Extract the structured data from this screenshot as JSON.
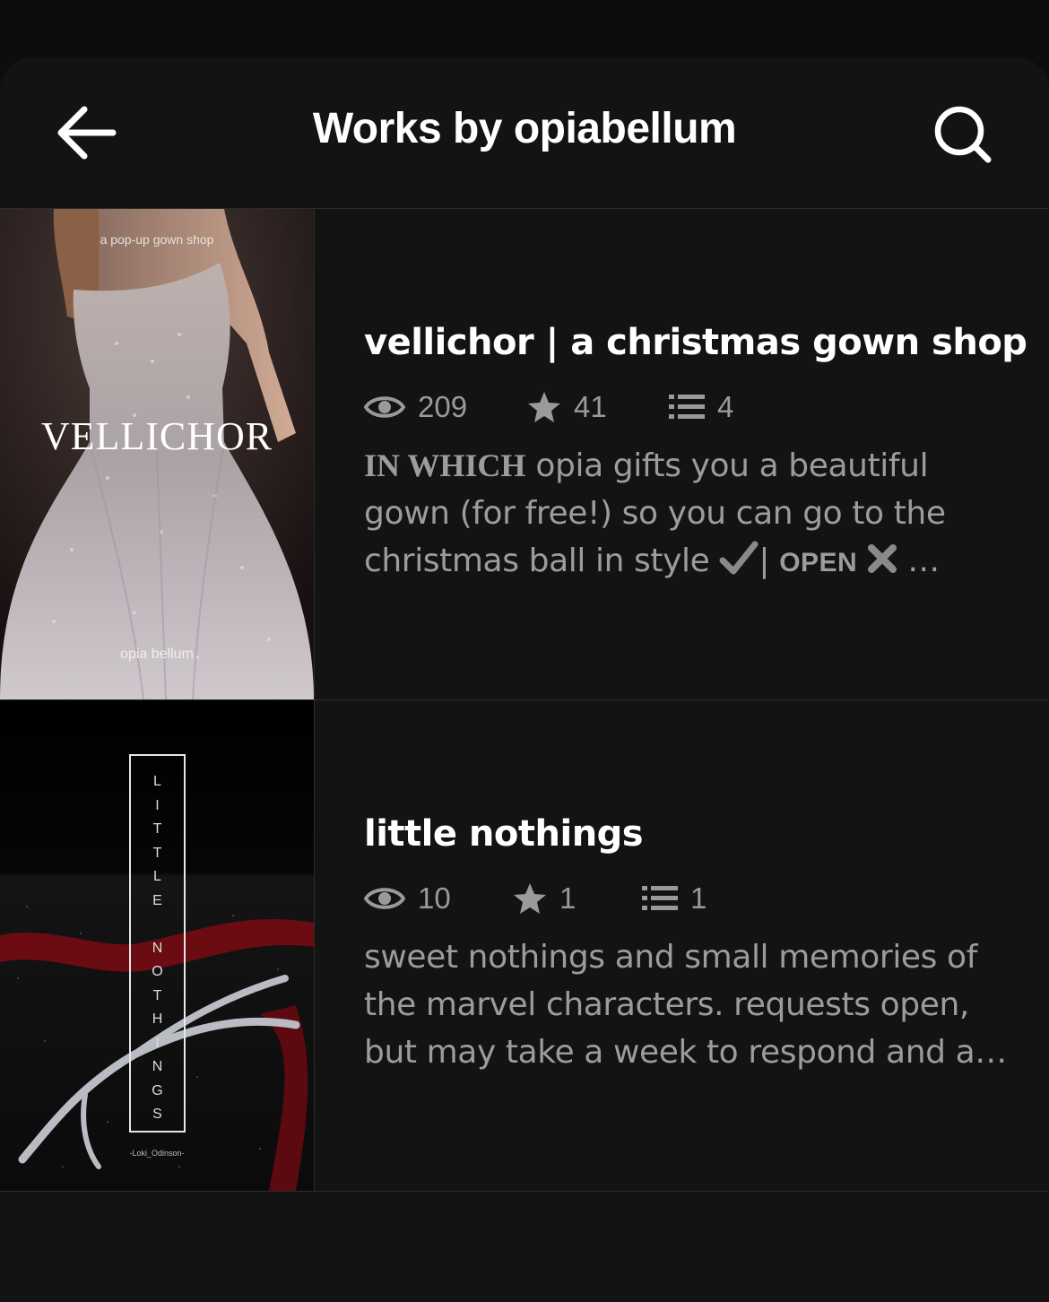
{
  "header": {
    "title": "Works by opiabellum",
    "back_icon": "arrow-left-icon",
    "search_icon": "search-icon"
  },
  "works": [
    {
      "title": "vellichor | a christmas gown shop",
      "reads": "209",
      "votes": "41",
      "parts": "4",
      "description_lead": "IN WHICH",
      "description_rest": " opia gifts you a beautiful gown (for free!) so you can go to the christmas ball in style ",
      "description_mid": "| ",
      "description_open": "OPEN",
      "description_tail": " …",
      "cover": {
        "top_text": "a pop-up gown shop",
        "title": "VELLICHOR",
        "author": "opia bellum"
      }
    },
    {
      "title": "little nothings",
      "reads": "10",
      "votes": "1",
      "parts": "1",
      "description": "sweet nothings and small memories of the marvel characters. requests open, but may take a week to respond and a…",
      "cover": {
        "letters": [
          "L",
          "I",
          "T",
          "T",
          "L",
          "E",
          "",
          "N",
          "O",
          "T",
          "H",
          "I",
          "N",
          "G",
          "S"
        ],
        "author": "-Loki_Odinson-"
      }
    }
  ],
  "colors": {
    "background": "#131313",
    "top_bar": "#0c0d0c",
    "text_primary": "#ffffff",
    "text_secondary": "#9c9c9c",
    "divider": "#2c2c2c"
  }
}
